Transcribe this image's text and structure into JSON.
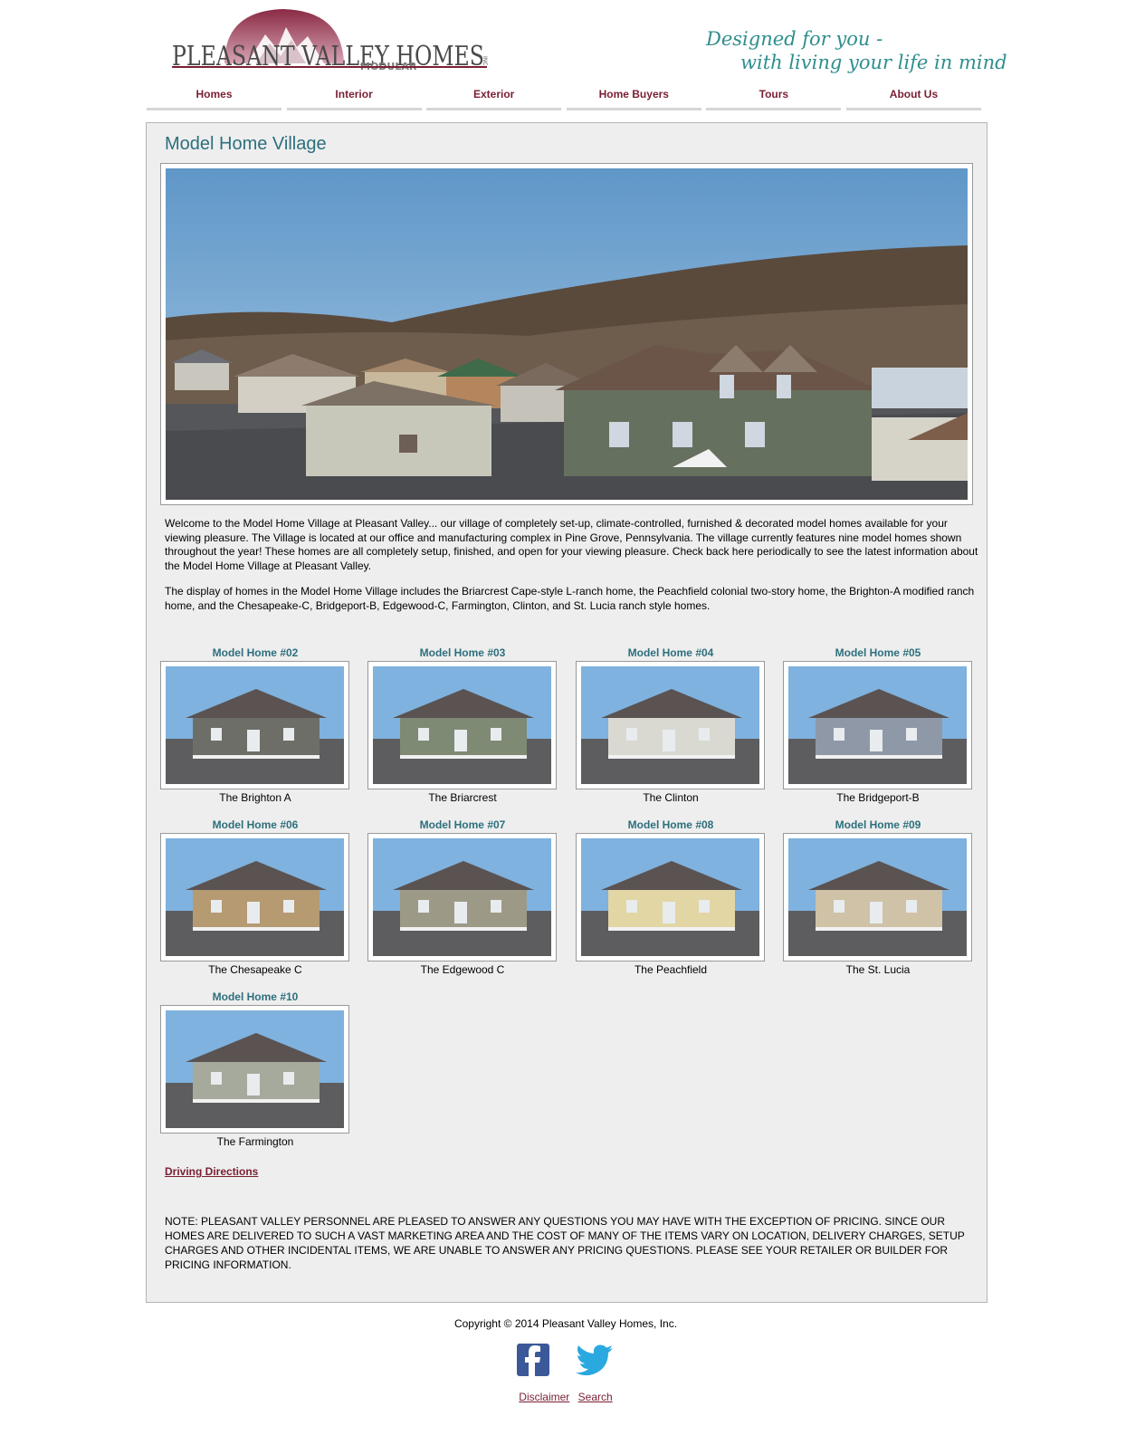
{
  "header": {
    "logo_text": "PLEASANT VALLEY HOMES",
    "logo_subtext": "MODULAR",
    "logo_inc": "INC",
    "tagline_line1": "Designed for you -",
    "tagline_line2": "with living your life in mind"
  },
  "nav": {
    "items": [
      {
        "label": "Homes"
      },
      {
        "label": "Interior"
      },
      {
        "label": "Exterior"
      },
      {
        "label": "Home Buyers"
      },
      {
        "label": "Tours"
      },
      {
        "label": "About Us"
      }
    ]
  },
  "main": {
    "title": "Model Home Village",
    "intro_1": "Welcome to the Model Home Village at Pleasant Valley... our village of completely set-up, climate-controlled, furnished & decorated model homes available for your viewing pleasure. The Village is located at our office and manufacturing complex in Pine Grove, Pennsylvania. The village currently features nine model homes shown throughout the year! These homes are all completely setup, finished, and open for your viewing pleasure. Check back here periodically to see the latest information about the Model Home Village at Pleasant Valley.",
    "intro_2": "The display of homes in the Model Home Village includes the Briarcrest Cape-style L-ranch home, the Peachfield colonial two-story home, the Brighton-A modified ranch home, and the Chesapeake-C, Bridgeport-B, Edgewood-C, Farmington, Clinton, and St. Lucia ranch style homes.",
    "models": [
      {
        "label": "Model Home #02",
        "caption": "The Brighton A",
        "house_color": "#6e6e68"
      },
      {
        "label": "Model Home #03",
        "caption": "The Briarcrest",
        "house_color": "#7e8a74"
      },
      {
        "label": "Model Home #04",
        "caption": "The Clinton",
        "house_color": "#d9d9d2"
      },
      {
        "label": "Model Home #05",
        "caption": "The Bridgeport-B",
        "house_color": "#8f98a6"
      },
      {
        "label": "Model Home #06",
        "caption": "The Chesapeake C",
        "house_color": "#b59a72"
      },
      {
        "label": "Model Home #07",
        "caption": "The Edgewood C",
        "house_color": "#9c9a86"
      },
      {
        "label": "Model Home #08",
        "caption": "The Peachfield",
        "house_color": "#e2d6a4"
      },
      {
        "label": "Model Home #09",
        "caption": "The St. Lucia",
        "house_color": "#cfc2a6"
      },
      {
        "label": "Model Home #10",
        "caption": "The Farmington",
        "house_color": "#a6aa9c"
      }
    ],
    "driving_link": "Driving Directions",
    "note": "NOTE: PLEASANT VALLEY PERSONNEL ARE PLEASED TO ANSWER ANY QUESTIONS YOU MAY HAVE WITH THE EXCEPTION OF PRICING. SINCE OUR HOMES ARE DELIVERED TO SUCH A VAST MARKETING AREA AND THE COST OF MANY OF THE ITEMS VARY ON LOCATION, DELIVERY CHARGES, SETUP CHARGES AND OTHER INCIDENTAL ITEMS, WE ARE UNABLE TO ANSWER ANY PRICING QUESTIONS. PLEASE SEE YOUR RETAILER OR BUILDER FOR PRICING INFORMATION."
  },
  "footer": {
    "copyright": "Copyright © 2014 Pleasant Valley Homes, Inc.",
    "social_icons": [
      "facebook-icon",
      "twitter-icon"
    ],
    "links": [
      {
        "label": "Disclaimer"
      },
      {
        "label": "Search"
      }
    ]
  },
  "colors": {
    "accent_maroon": "#7a1f33",
    "heading_teal": "#2d6f7d",
    "tagline_teal": "#2f8e8e",
    "panel_bg": "#eeeeee"
  }
}
